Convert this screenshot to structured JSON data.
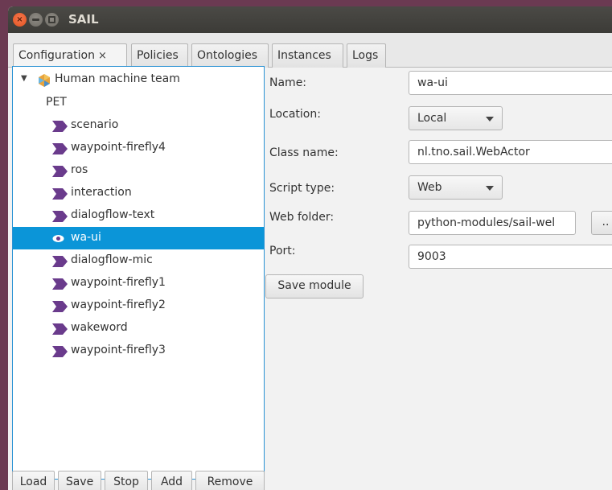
{
  "window": {
    "title": "SAIL"
  },
  "tabs": [
    {
      "label": "Configuration",
      "closable_glyph": "×"
    },
    {
      "label": "Policies"
    },
    {
      "label": "Ontologies"
    },
    {
      "label": "Instances"
    },
    {
      "label": "Logs"
    }
  ],
  "tree": {
    "root": {
      "label": "Human machine team",
      "icon": "team-icon",
      "expanded": true
    },
    "group": {
      "label": "PET"
    },
    "items": [
      {
        "label": "scenario",
        "icon": "module-chevron-icon"
      },
      {
        "label": "waypoint-firefly4",
        "icon": "module-chevron-icon"
      },
      {
        "label": "ros",
        "icon": "module-chevron-icon"
      },
      {
        "label": "interaction",
        "icon": "module-chevron-icon"
      },
      {
        "label": "dialogflow-text",
        "icon": "module-chevron-icon"
      },
      {
        "label": "wa-ui",
        "icon": "eye-icon",
        "selected": true
      },
      {
        "label": "dialogflow-mic",
        "icon": "module-chevron-icon"
      },
      {
        "label": "waypoint-firefly1",
        "icon": "module-chevron-icon"
      },
      {
        "label": "waypoint-firefly2",
        "icon": "module-chevron-icon"
      },
      {
        "label": "wakeword",
        "icon": "module-chevron-icon"
      },
      {
        "label": "waypoint-firefly3",
        "icon": "module-chevron-icon"
      }
    ]
  },
  "bottom_buttons": [
    "Load",
    "Save",
    "Stop",
    "Add",
    "Remove"
  ],
  "form": {
    "name_label": "Name:",
    "name_value": "wa-ui",
    "location_label": "Location:",
    "location_value": "Local",
    "class_label": "Class name:",
    "class_value": "nl.tno.sail.WebActor",
    "script_label": "Script type:",
    "script_value": "Web",
    "folder_label": "Web folder:",
    "folder_value": "python-modules/sail-wel",
    "browse_label": "..",
    "port_label": "Port:",
    "port_value": "9003",
    "save_label": "Save module"
  },
  "colors": {
    "selection": "#0b95d8",
    "module_icon": "#6a3b8c",
    "tree_border": "#2a92d4",
    "close_button": "#e95420"
  }
}
